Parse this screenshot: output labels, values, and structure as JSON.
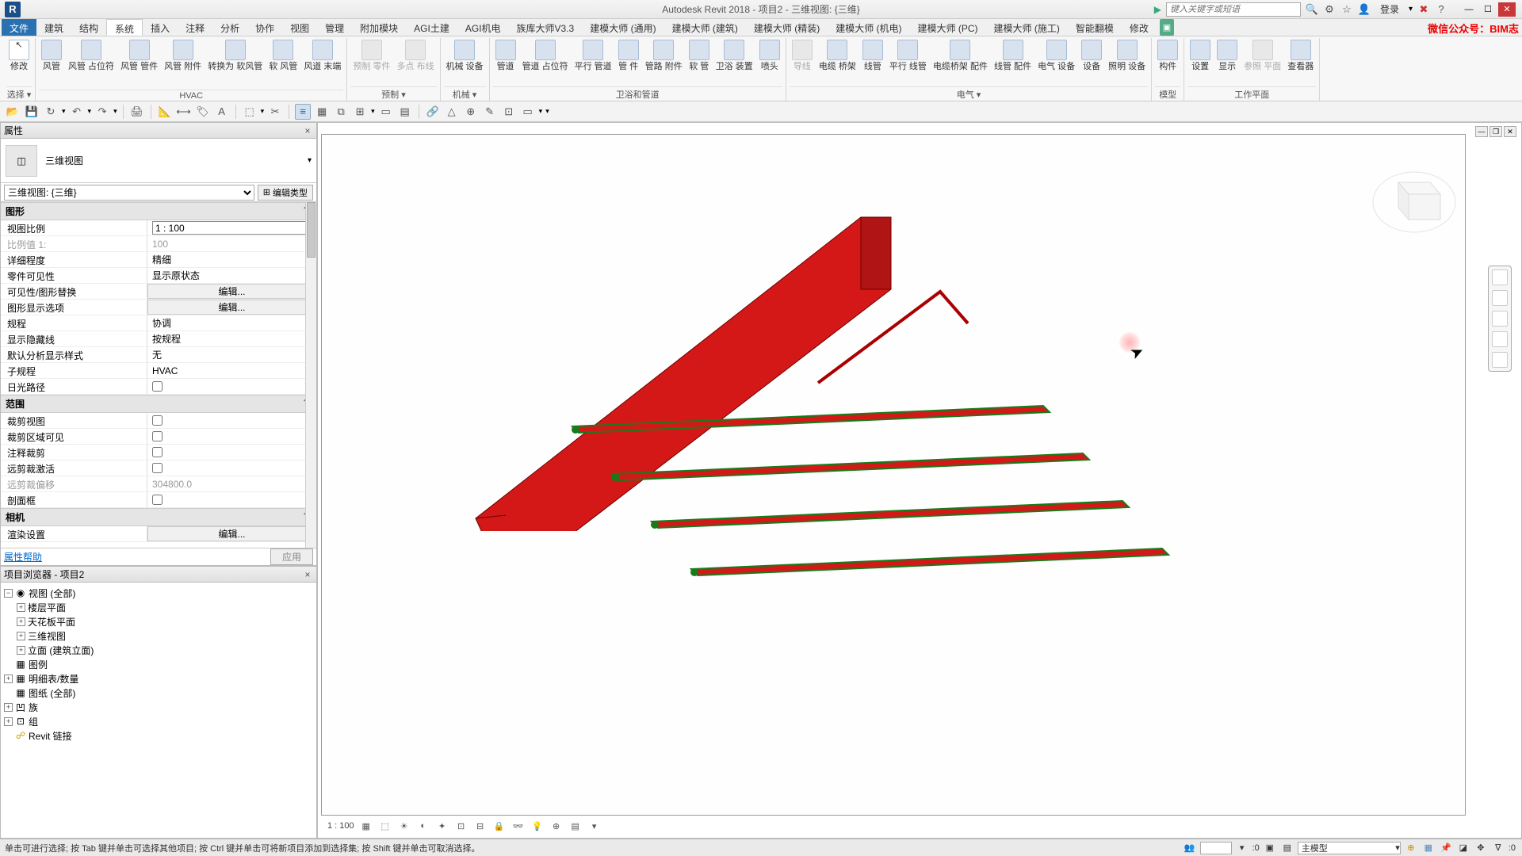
{
  "app": {
    "letter": "R",
    "title": "Autodesk Revit 2018 -    项目2 - 三维视图: {三维}",
    "search_ph": "键入关键字或短语",
    "login": "登录",
    "wx": "微信公众号：BIM志"
  },
  "menu": {
    "file": "文件",
    "tabs": [
      "建筑",
      "结构",
      "系统",
      "插入",
      "注释",
      "分析",
      "协作",
      "视图",
      "管理",
      "附加模块",
      "AGI土建",
      "AGI机电",
      "族库大师V3.3",
      "建模大师 (通用)",
      "建模大师 (建筑)",
      "建模大师 (精装)",
      "建模大师 (机电)",
      "建模大师 (PC)",
      "建模大师 (施工)",
      "智能翻模",
      "修改"
    ],
    "active": "系统"
  },
  "ribbon": {
    "sel_grp": "选择",
    "sel_btn": "修改",
    "hvac": {
      "label": "HVAC",
      "btns": [
        "风管",
        "风管\n占位符",
        "风管\n管件",
        "风管\n附件",
        "转换为\n软风管",
        "软\n风管",
        "风道\n末端"
      ]
    },
    "prefab": {
      "label": "预制",
      "btns": [
        "预制\n零件",
        "多点\n布线"
      ]
    },
    "mech": {
      "label": "机械 ▾",
      "btns": [
        "机械\n设备"
      ]
    },
    "plumb": {
      "label": "卫浴和管道",
      "btns": [
        "管道",
        "管道\n占位符",
        "平行\n管道",
        "管\n件",
        "管路\n附件",
        "软\n管",
        "卫浴\n装置",
        "喷头"
      ]
    },
    "elec": {
      "label": "电气",
      "btns": [
        "导线",
        "电缆\n桥架",
        "线管",
        "平行\n线管",
        "电缆桥架\n配件",
        "线管\n配件",
        "电气\n设备",
        "设备",
        "照明\n设备"
      ]
    },
    "model": {
      "label": "模型",
      "btns": [
        "构件",
        "设置"
      ]
    },
    "wp": {
      "label": "工作平面",
      "btns": [
        "显示",
        "参照\n平面",
        "查看器"
      ]
    }
  },
  "panels": {
    "props": "属性",
    "browser": "项目浏览器 - 项目2"
  },
  "proptype": {
    "name": "三维视图"
  },
  "filter": {
    "value": "三维视图: {三维}",
    "edit": "编辑类型"
  },
  "sections": {
    "s1": "图形",
    "s2": "范围",
    "s3": "相机"
  },
  "p": {
    "scale_k": "视图比例",
    "scale_v": "1 : 100",
    "sv_k": "比例值 1:",
    "sv_v": "100",
    "detail_k": "详细程度",
    "detail_v": "精细",
    "partvis_k": "零件可见性",
    "partvis_v": "显示原状态",
    "vg_k": "可见性/图形替换",
    "vg_v": "编辑...",
    "gdo_k": "图形显示选项",
    "gdo_v": "编辑...",
    "disc_k": "规程",
    "disc_v": "协调",
    "hid_k": "显示隐藏线",
    "hid_v": "按规程",
    "ads_k": "默认分析显示样式",
    "ads_v": "无",
    "sub_k": "子规程",
    "sub_v": "HVAC",
    "sun_k": "日光路径",
    "crop_k": "裁剪视图",
    "cropr_k": "裁剪区域可见",
    "ann_k": "注释裁剪",
    "far_k": "远剪裁激活",
    "faroff_k": "远剪裁偏移",
    "faroff_v": "304800.0",
    "box_k": "剖面框",
    "render_k": "渲染设置",
    "render_v": "编辑..."
  },
  "propfoot": {
    "help": "属性帮助",
    "apply": "应用"
  },
  "tree": {
    "root": "视图 (全部)",
    "n1": "楼层平面",
    "n2": "天花板平面",
    "n3": "三维视图",
    "n4": "立面 (建筑立面)",
    "n5": "图例",
    "n6": "明细表/数量",
    "n7": "图纸 (全部)",
    "n8": "族",
    "n9": "组",
    "n10": "Revit 链接"
  },
  "viewbar": {
    "scale": "1 : 100"
  },
  "status": {
    "hint": "单击可进行选择; 按 Tab 键并单击可选择其他项目; 按 Ctrl 键并单击可将新项目添加到选择集; 按 Shift 键并单击可取消选择。",
    "zero": ":0",
    "model": "主模型"
  }
}
